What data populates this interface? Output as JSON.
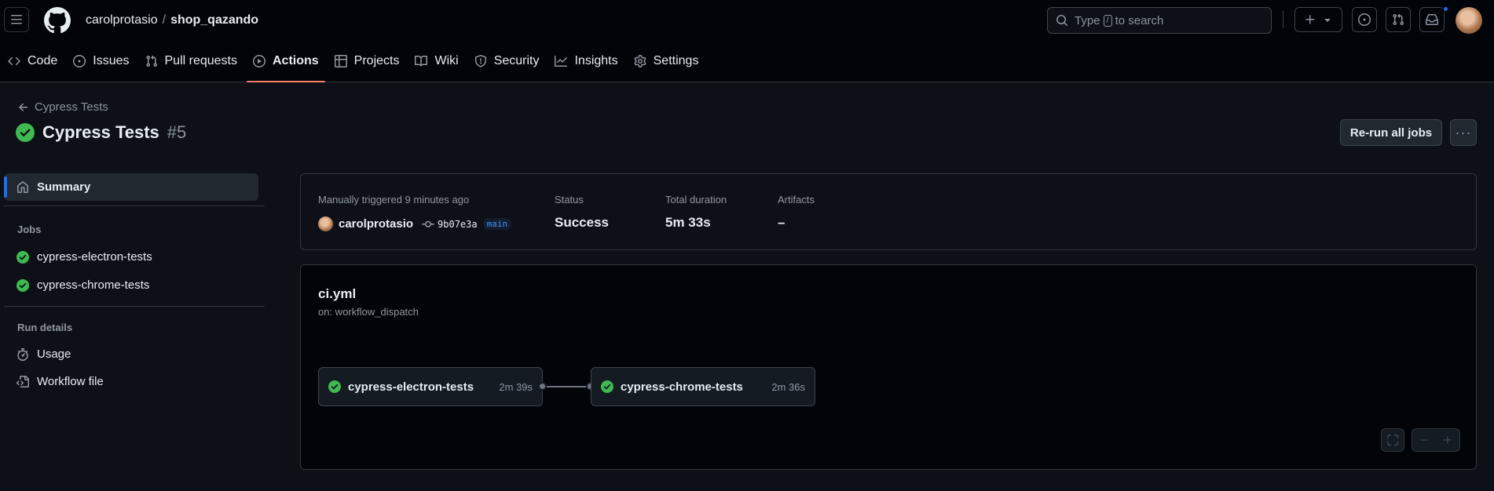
{
  "header": {
    "owner": "carolprotasio",
    "separator": "/",
    "repo": "shop_qazando",
    "search": {
      "prefix": "Type",
      "key": "/",
      "suffix": "to search"
    }
  },
  "nav": [
    {
      "label": "Code",
      "icon": "code-icon"
    },
    {
      "label": "Issues",
      "icon": "issue-opened-icon"
    },
    {
      "label": "Pull requests",
      "icon": "git-pull-request-icon"
    },
    {
      "label": "Actions",
      "icon": "play-icon",
      "active": true
    },
    {
      "label": "Projects",
      "icon": "table-icon"
    },
    {
      "label": "Wiki",
      "icon": "book-icon"
    },
    {
      "label": "Security",
      "icon": "shield-icon"
    },
    {
      "label": "Insights",
      "icon": "graph-icon"
    },
    {
      "label": "Settings",
      "icon": "gear-icon"
    }
  ],
  "run": {
    "back_label": "Cypress Tests",
    "title": "Cypress Tests",
    "number": "#5",
    "rerun_label": "Re-run all jobs",
    "more_label": "···"
  },
  "sidebar": {
    "summary": "Summary",
    "jobs_heading": "Jobs",
    "jobs": [
      "cypress-electron-tests",
      "cypress-chrome-tests"
    ],
    "run_details_heading": "Run details",
    "details": [
      "Usage",
      "Workflow file"
    ]
  },
  "summary": {
    "trigger_label": "Manually triggered 9 minutes ago",
    "actor": "carolprotasio",
    "sha": "9b07e3a",
    "branch": "main",
    "status_label": "Status",
    "status": "Success",
    "duration_label": "Total duration",
    "duration": "5m 33s",
    "artifacts_label": "Artifacts",
    "artifacts": "–"
  },
  "workflow": {
    "file": "ci.yml",
    "trigger": "on: workflow_dispatch",
    "jobs": [
      {
        "name": "cypress-electron-tests",
        "duration": "2m 39s"
      },
      {
        "name": "cypress-chrome-tests",
        "duration": "2m 36s"
      }
    ],
    "zoom_minus": "−",
    "zoom_plus": "+"
  },
  "colors": {
    "success": "#3fb950",
    "accent": "#f78166",
    "link": "#4493f8"
  }
}
